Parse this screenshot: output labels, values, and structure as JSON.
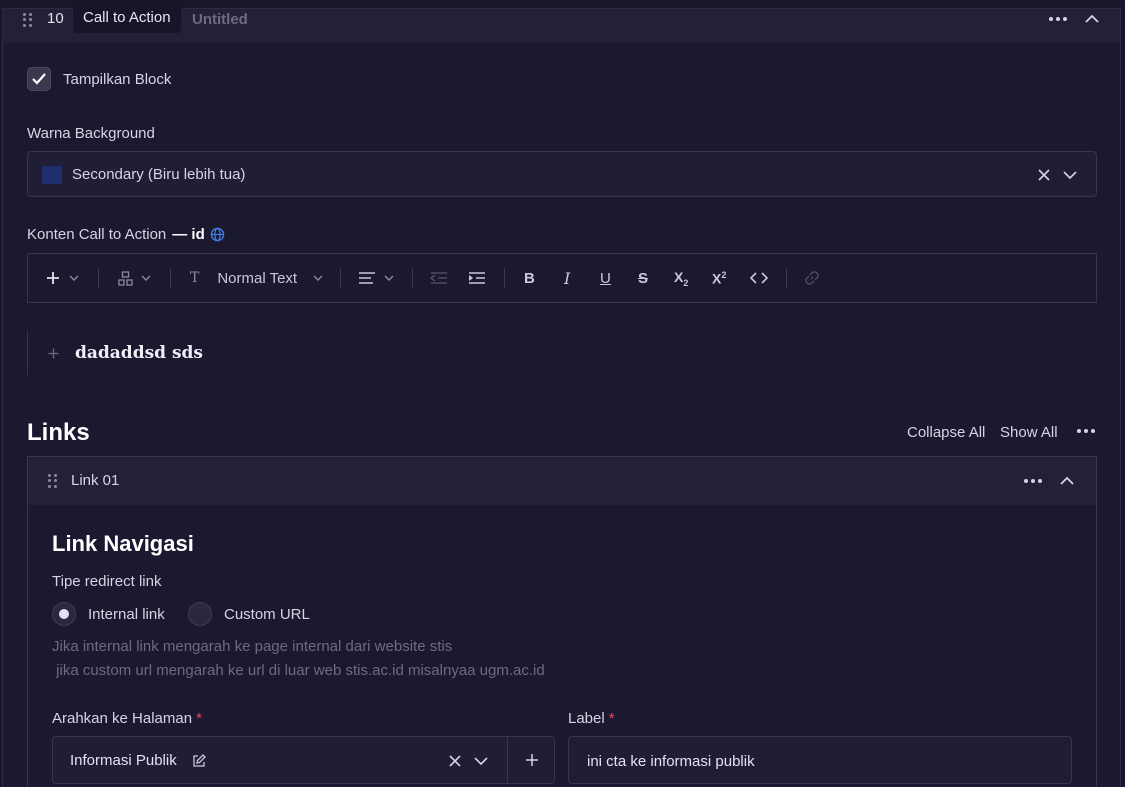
{
  "block": {
    "number": "10",
    "type": "Call to Action",
    "title": "Untitled"
  },
  "show_block": {
    "label": "Tampilkan Block",
    "checked": true
  },
  "background": {
    "label": "Warna Background",
    "value": "Secondary (Biru lebih tua)",
    "swatch_color": "#1f2e6e"
  },
  "content": {
    "label": "Konten Call to Action",
    "locale_label": "— id",
    "toolbar": {
      "text_style": "Normal Text"
    },
    "text": "dadaddsd sds"
  },
  "links": {
    "title": "Links",
    "collapse_all": "Collapse All",
    "show_all": "Show All",
    "items": [
      {
        "name": "Link 01",
        "heading": "Link Navigasi",
        "redirect_label": "Tipe redirect link",
        "options": [
          "Internal link",
          "Custom URL"
        ],
        "selected": "Internal link",
        "help_line1": "Jika internal link mengarah ke page internal dari website stis",
        "help_line2": " jika custom url mengarah ke url di luar web stis.ac.id misalnyaa ugm.ac.id",
        "page_label": "Arahkan ke Halaman",
        "page_value": "Informasi Publik",
        "label_label": "Label",
        "label_value": "ini cta ke informasi publik",
        "required_mark": "*"
      }
    ]
  }
}
